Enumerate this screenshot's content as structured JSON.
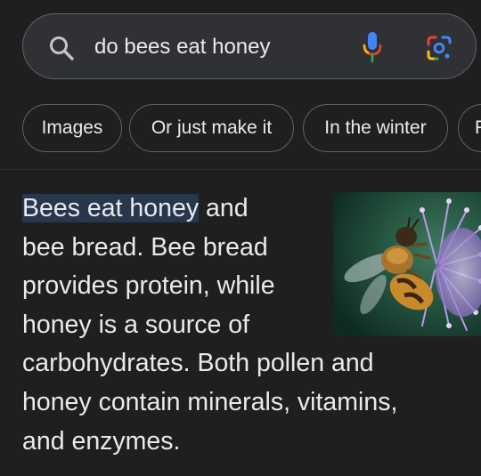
{
  "search": {
    "query": "do bees eat honey"
  },
  "chips": [
    {
      "label": "Images"
    },
    {
      "label": "Or just make it"
    },
    {
      "label": "In the winter"
    },
    {
      "label": "F"
    }
  ],
  "answer": {
    "highlight": "Bees eat honey",
    "line1_rest": " and",
    "line2": "bee bread. Bee bread",
    "line3": "provides protein, while",
    "line4": "honey is a source of",
    "line5": "carbohydrates. Both pollen and",
    "line6": "honey contain minerals, vitamins,",
    "line7": "and enzymes."
  },
  "icons": {
    "search": "search-icon",
    "mic": "mic-icon",
    "lens": "google-lens-icon"
  },
  "colors": {
    "background": "#1f1f1f",
    "search_bar": "#303134",
    "highlight": "#27374d",
    "text": "#e8eaed",
    "border": "#5f6368"
  }
}
